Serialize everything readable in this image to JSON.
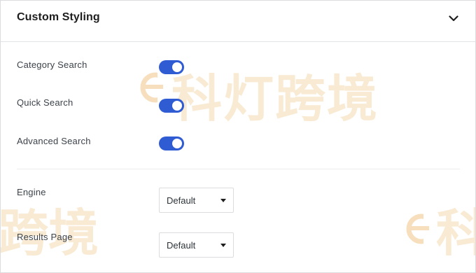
{
  "panel": {
    "title": "Custom Styling",
    "collapse_icon": "chevron-down-icon"
  },
  "toggles": [
    {
      "label": "Category Search",
      "on": true
    },
    {
      "label": "Quick Search",
      "on": true
    },
    {
      "label": "Advanced Search",
      "on": true
    }
  ],
  "selects": [
    {
      "label": "Engine",
      "value": "Default"
    },
    {
      "label": "Results Page",
      "value": "Default"
    }
  ],
  "watermark": {
    "text_main": "科灯跨境",
    "text_left": "跨境",
    "text_right": "科"
  },
  "colors": {
    "toggle_on": "#2f5bd3",
    "watermark": "#f5d9b0"
  }
}
